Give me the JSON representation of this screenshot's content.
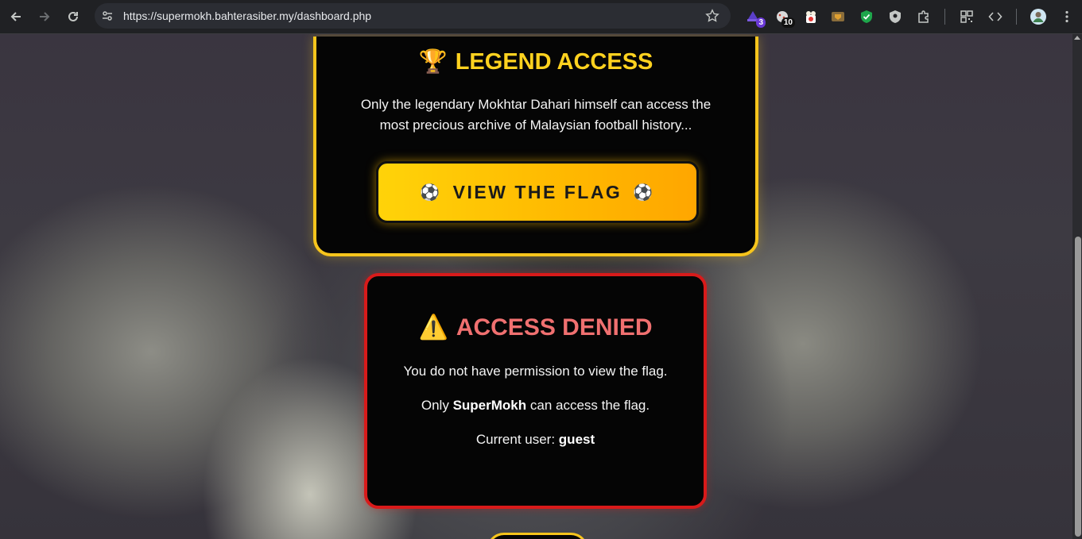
{
  "browser": {
    "url": "https://supermokh.bahterasiber.my/dashboard.php",
    "extensions": [
      {
        "icon": "hat-extension-icon",
        "badge": "3",
        "badge_color": "#6a39d6"
      },
      {
        "icon": "cookie-extension-icon",
        "badge": "10",
        "badge_color": "#111111"
      },
      {
        "icon": "popcorn-extension-icon",
        "badge": "",
        "badge_color": ""
      },
      {
        "icon": "crest-extension-icon",
        "badge": "",
        "badge_color": ""
      },
      {
        "icon": "green-shield-extension-icon",
        "badge": "",
        "badge_color": ""
      },
      {
        "icon": "grey-shield-extension-icon",
        "badge": "",
        "badge_color": ""
      }
    ]
  },
  "legend": {
    "trophy": "🏆",
    "title": "LEGEND ACCESS",
    "description_line1": "Only the legendary Mokhtar Dahari himself can access the",
    "description_line2": "most precious archive of Malaysian football history...",
    "button_ball": "⚽",
    "button_label": "VIEW THE FLAG"
  },
  "denied": {
    "warning": "⚠️",
    "title": "ACCESS DENIED",
    "line1": "You do not have permission to view the flag.",
    "line2_prefix": "Only",
    "line2_user": "SuperMokh",
    "line2_suffix": "can access the flag.",
    "line3_prefix": "Current user:",
    "line3_user": "guest"
  },
  "colors": {
    "gold": "#ffd21f",
    "deny_red": "#d91a1a",
    "deny_text": "#f07070"
  }
}
